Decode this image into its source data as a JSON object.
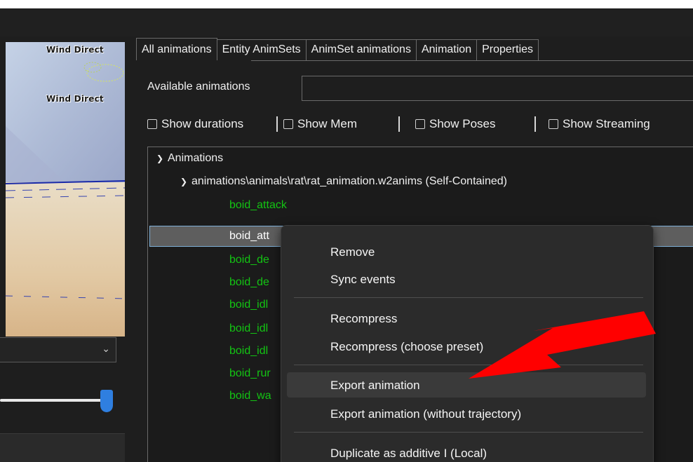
{
  "viewport": {
    "wind_label_1": "Wind Direct",
    "wind_label_2": "Wind Direct"
  },
  "tabs": [
    {
      "label": "All animations",
      "active": true
    },
    {
      "label": "Entity AnimSets"
    },
    {
      "label": "AnimSet animations"
    },
    {
      "label": "Animation"
    },
    {
      "label": "Properties"
    }
  ],
  "available_animations": {
    "label": "Available animations",
    "value": ""
  },
  "checkboxes": [
    {
      "label": "Show durations",
      "checked": false
    },
    {
      "label": "Show Mem",
      "checked": false
    },
    {
      "label": "Show Poses",
      "checked": false
    },
    {
      "label": "Show Streaming",
      "checked": false
    }
  ],
  "tree": {
    "root": "Animations",
    "file": "animations\\animals\\rat\\rat_animation.w2anims (Self-Contained)",
    "animations": [
      "boid_attack",
      "boid_att",
      "boid_de",
      "boid_de",
      "boid_idl",
      "boid_idl",
      "boid_idl",
      "boid_rur",
      "boid_wa"
    ],
    "selected_index": 1
  },
  "context_menu": {
    "items": [
      {
        "label": "Remove"
      },
      {
        "label": "Sync events"
      },
      {
        "label": "Recompress"
      },
      {
        "label": "Recompress (choose preset)"
      },
      {
        "label": "Export animation",
        "highlighted": true
      },
      {
        "label": "Export animation (without trajectory)"
      },
      {
        "label": "Duplicate as additive I (Local)"
      }
    ]
  },
  "colors": {
    "animation_text": "#13c413",
    "arrow": "#ff0000",
    "slider_thumb": "#2f7fe0"
  }
}
